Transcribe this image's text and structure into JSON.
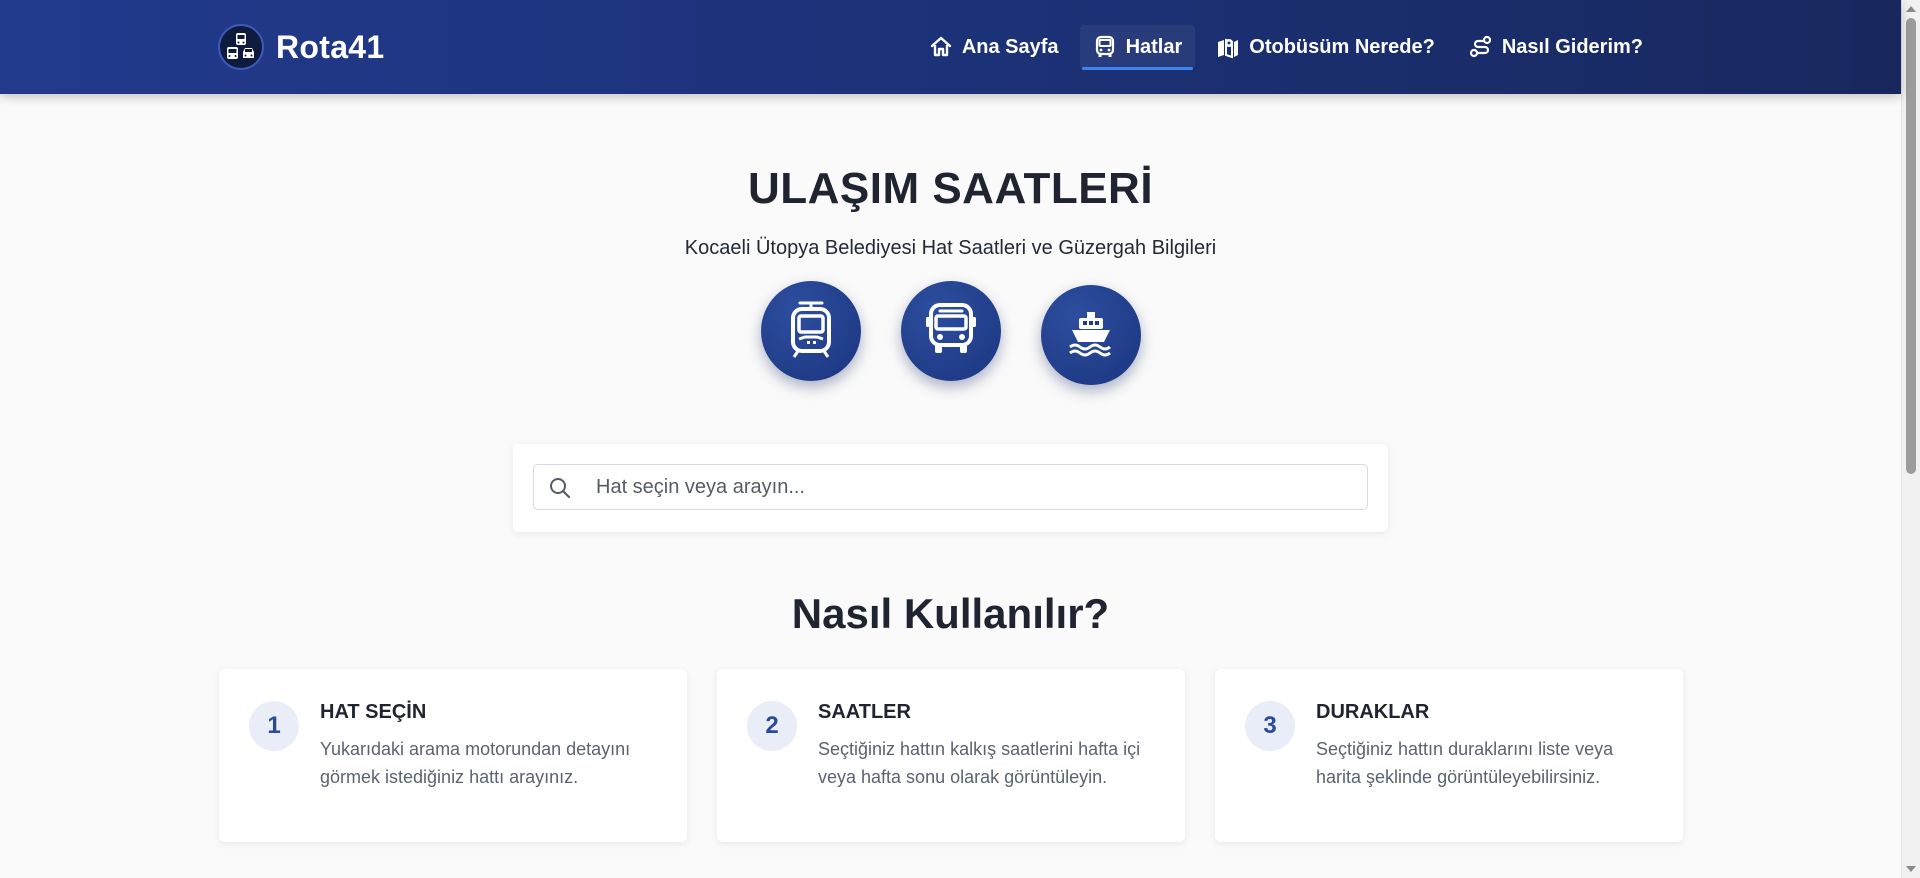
{
  "brand": {
    "name": "Rota41",
    "logo_icon": "transit-vehicles-logo-icon"
  },
  "nav": {
    "items": [
      {
        "label": "Ana Sayfa",
        "icon": "home-icon",
        "active": false
      },
      {
        "label": "Hatlar",
        "icon": "bus-front-icon",
        "active": true
      },
      {
        "label": "Otobüsüm Nerede?",
        "icon": "map-location-icon",
        "active": false
      },
      {
        "label": "Nasıl Giderim?",
        "icon": "route-icon",
        "active": false
      }
    ]
  },
  "hero": {
    "title": "ULAŞIM SAATLERİ",
    "subtitle": "Kocaeli Ütopya Belediyesi Hat Saatleri ve Güzergah Bilgileri",
    "modes": [
      {
        "icon": "tram-icon"
      },
      {
        "icon": "bus-icon"
      },
      {
        "icon": "ferry-icon"
      }
    ]
  },
  "search": {
    "placeholder": "Hat seçin veya arayın...",
    "value": ""
  },
  "how_to": {
    "title": "Nasıl Kullanılır?",
    "steps": [
      {
        "number": "1",
        "title": "HAT SEÇİN",
        "description": "Yukarıdaki arama motorundan detayını görmek istediğiniz hattı arayınız."
      },
      {
        "number": "2",
        "title": "SAATLER",
        "description": "Seçtiğiniz hattın kalkış saatlerini hafta içi veya hafta sonu olarak görüntüleyin."
      },
      {
        "number": "3",
        "title": "DURAKLAR",
        "description": "Seçtiğiniz hattın duraklarını liste veya harita şeklinde görüntüleyebilirsiniz."
      }
    ]
  },
  "colors": {
    "header_start": "#213a8c",
    "header_end": "#18285e",
    "active_underline": "#3f82f0",
    "mode_circle": "#1f3a86",
    "step_number_bg": "#e8edf7",
    "step_number_text": "#2a4a9a"
  }
}
